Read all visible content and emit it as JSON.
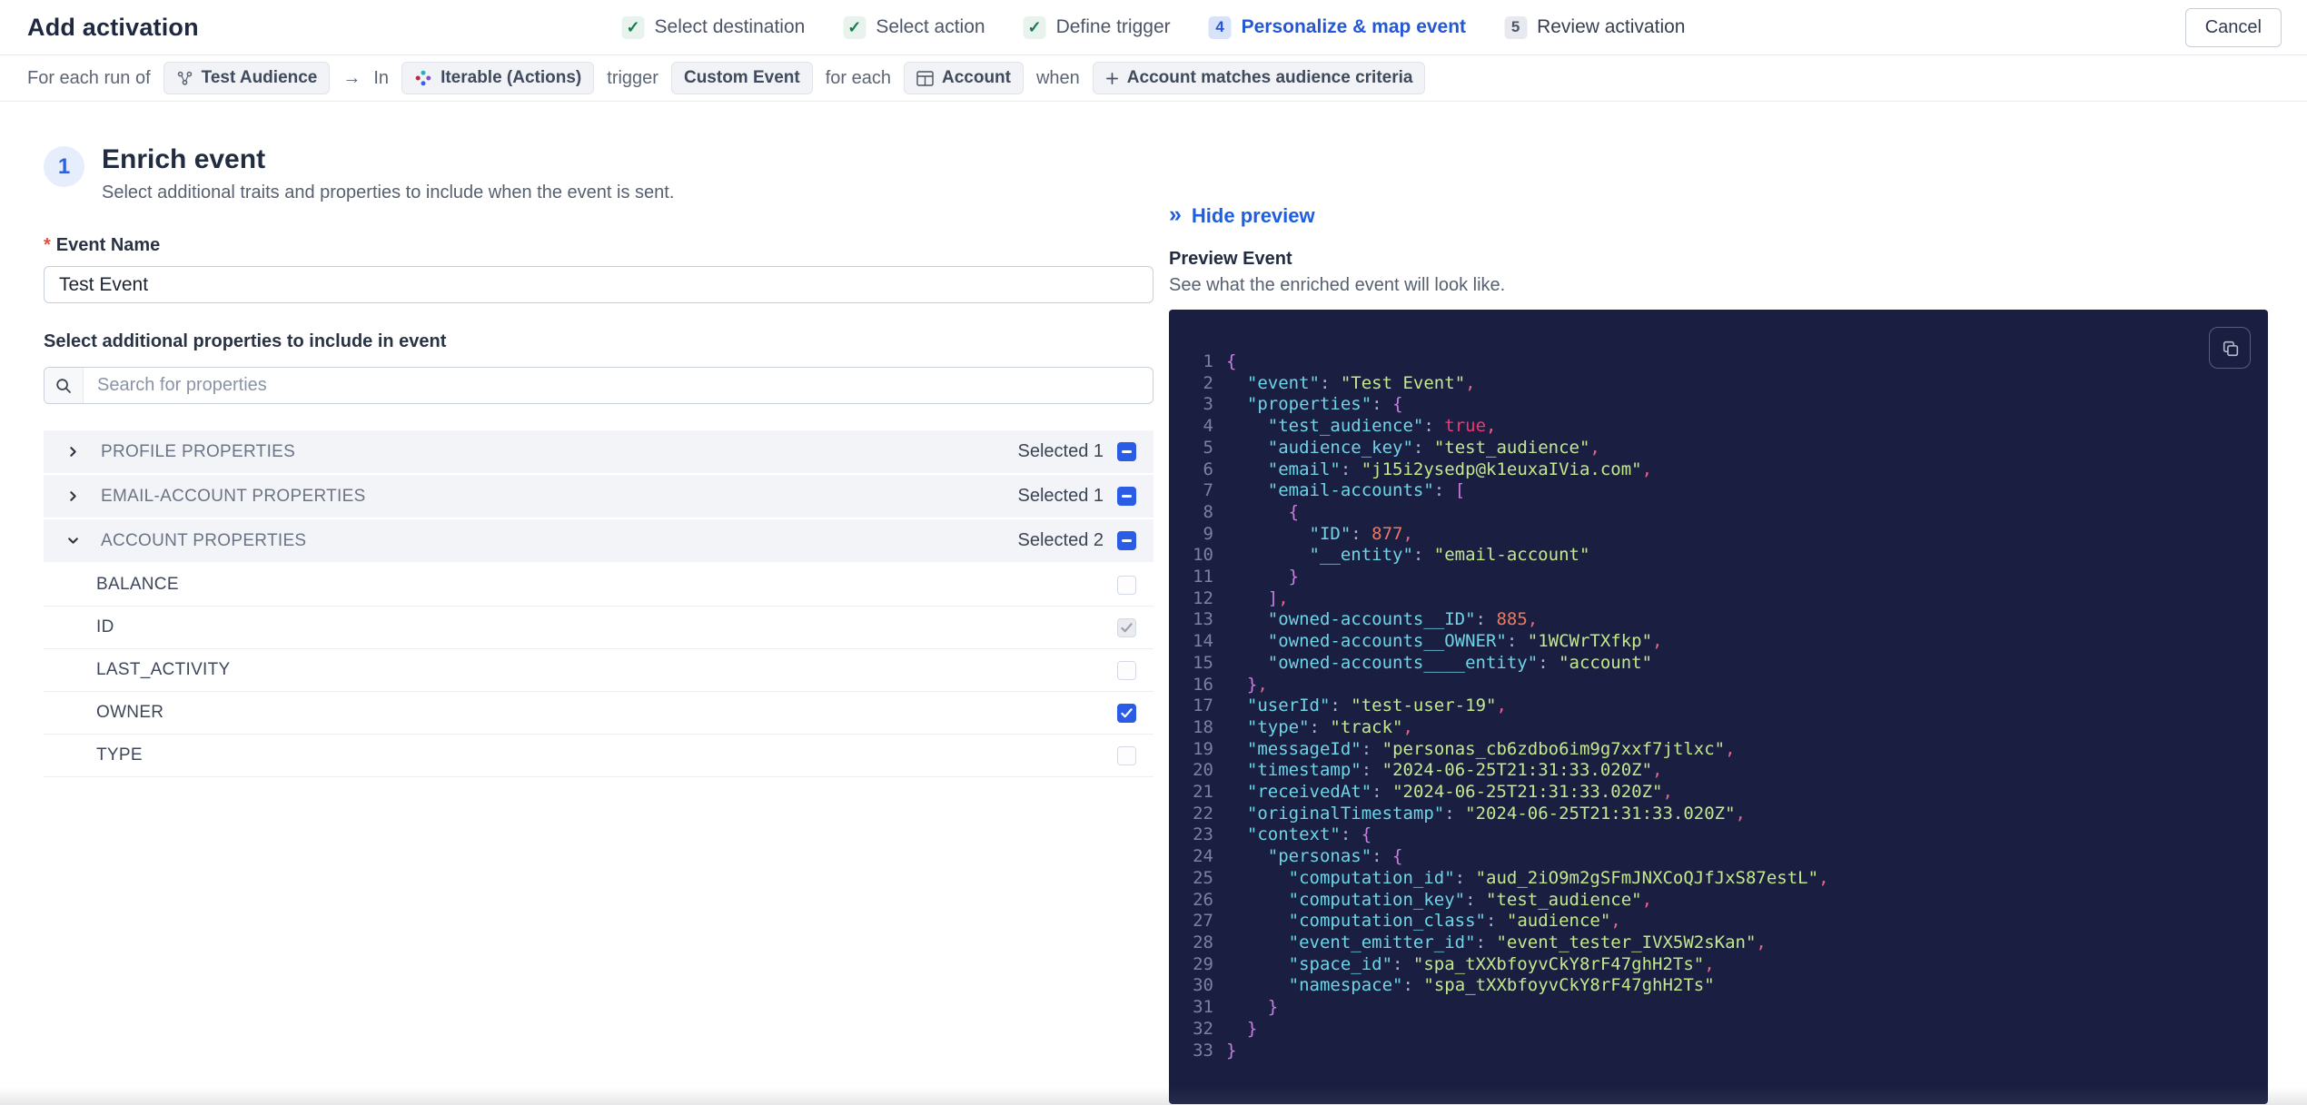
{
  "header": {
    "title": "Add activation",
    "cancel_label": "Cancel",
    "steps": [
      {
        "label": "Select destination",
        "state": "done"
      },
      {
        "label": "Select action",
        "state": "done"
      },
      {
        "label": "Define trigger",
        "state": "done"
      },
      {
        "label": "Personalize & map event",
        "state": "active",
        "number": "4"
      },
      {
        "label": "Review activation",
        "state": "upcoming",
        "number": "5"
      }
    ]
  },
  "context_bar": {
    "parts": [
      {
        "type": "text",
        "text": "For each run of"
      },
      {
        "type": "chip",
        "icon": "audience-icon",
        "label": "Test Audience"
      },
      {
        "type": "text",
        "text": "→"
      },
      {
        "type": "text",
        "text": "In"
      },
      {
        "type": "chip",
        "icon": "iterable-icon",
        "label": "Iterable (Actions)"
      },
      {
        "type": "text",
        "text": "trigger"
      },
      {
        "type": "chip",
        "icon": "",
        "label": "Custom Event"
      },
      {
        "type": "text",
        "text": "for each"
      },
      {
        "type": "chip",
        "icon": "table-icon",
        "label": "Account"
      },
      {
        "type": "text",
        "text": "when"
      },
      {
        "type": "chip",
        "icon": "plus-icon",
        "label": "Account matches audience criteria"
      }
    ]
  },
  "enrich": {
    "step_number": "1",
    "title": "Enrich event",
    "subtitle": "Select additional traits and properties to include when the event is sent.",
    "required_marker": "*",
    "event_name_label": "Event Name",
    "event_name_value": "Test Event",
    "properties_label": "Select additional properties to include in event",
    "search_placeholder": "Search for properties",
    "sections": [
      {
        "label": "PROFILE PROPERTIES",
        "selected": "Selected 1",
        "expanded": false,
        "items": []
      },
      {
        "label": "EMAIL-ACCOUNT PROPERTIES",
        "selected": "Selected 1",
        "expanded": false,
        "items": []
      },
      {
        "label": "ACCOUNT PROPERTIES",
        "selected": "Selected 2",
        "expanded": true,
        "items": [
          {
            "label": "BALANCE",
            "checkbox": "unchecked"
          },
          {
            "label": "ID",
            "checkbox": "checked-disabled"
          },
          {
            "label": "LAST_ACTIVITY",
            "checkbox": "unchecked"
          },
          {
            "label": "OWNER",
            "checkbox": "checked"
          },
          {
            "label": "TYPE",
            "checkbox": "unchecked"
          }
        ]
      }
    ]
  },
  "preview": {
    "hide_label": "Hide preview",
    "collapse_icon": "double-chevron-right-icon",
    "copy_icon": "copy-icon",
    "title": "Preview Event",
    "subtitle": "See what the enriched event will look like.",
    "code_lines": [
      {
        "n": 1,
        "indent": 0,
        "tokens": [
          [
            "brace",
            "{"
          ]
        ]
      },
      {
        "n": 2,
        "indent": 1,
        "tokens": [
          [
            "key",
            "\"event\""
          ],
          [
            "colon",
            ": "
          ],
          [
            "str",
            "\"Test Event\""
          ],
          [
            "comma",
            ","
          ]
        ]
      },
      {
        "n": 3,
        "indent": 1,
        "tokens": [
          [
            "key",
            "\"properties\""
          ],
          [
            "colon",
            ": "
          ],
          [
            "brace",
            "{"
          ]
        ]
      },
      {
        "n": 4,
        "indent": 2,
        "tokens": [
          [
            "key",
            "\"test_audience\""
          ],
          [
            "colon",
            ": "
          ],
          [
            "bool",
            "true"
          ],
          [
            "comma",
            ","
          ]
        ]
      },
      {
        "n": 5,
        "indent": 2,
        "tokens": [
          [
            "key",
            "\"audience_key\""
          ],
          [
            "colon",
            ": "
          ],
          [
            "str",
            "\"test_audience\""
          ],
          [
            "comma",
            ","
          ]
        ]
      },
      {
        "n": 6,
        "indent": 2,
        "tokens": [
          [
            "key",
            "\"email\""
          ],
          [
            "colon",
            ": "
          ],
          [
            "str",
            "\"j15i2ysedp@k1euxaIVia.com\""
          ],
          [
            "comma",
            ","
          ]
        ]
      },
      {
        "n": 7,
        "indent": 2,
        "tokens": [
          [
            "key",
            "\"email-accounts\""
          ],
          [
            "colon",
            ": "
          ],
          [
            "bracket",
            "["
          ]
        ]
      },
      {
        "n": 8,
        "indent": 3,
        "tokens": [
          [
            "brace",
            "{"
          ]
        ]
      },
      {
        "n": 9,
        "indent": 4,
        "tokens": [
          [
            "key",
            "\"ID\""
          ],
          [
            "colon",
            ": "
          ],
          [
            "num",
            "877"
          ],
          [
            "comma",
            ","
          ]
        ]
      },
      {
        "n": 10,
        "indent": 4,
        "tokens": [
          [
            "key",
            "\"__entity\""
          ],
          [
            "colon",
            ": "
          ],
          [
            "str",
            "\"email-account\""
          ]
        ]
      },
      {
        "n": 11,
        "indent": 3,
        "tokens": [
          [
            "brace",
            "}"
          ]
        ]
      },
      {
        "n": 12,
        "indent": 2,
        "tokens": [
          [
            "bracket",
            "]"
          ],
          [
            "comma",
            ","
          ]
        ]
      },
      {
        "n": 13,
        "indent": 2,
        "tokens": [
          [
            "key",
            "\"owned-accounts__ID\""
          ],
          [
            "colon",
            ": "
          ],
          [
            "num",
            "885"
          ],
          [
            "comma",
            ","
          ]
        ]
      },
      {
        "n": 14,
        "indent": 2,
        "tokens": [
          [
            "key",
            "\"owned-accounts__OWNER\""
          ],
          [
            "colon",
            ": "
          ],
          [
            "str",
            "\"1WCWrTXfkp\""
          ],
          [
            "comma",
            ","
          ]
        ]
      },
      {
        "n": 15,
        "indent": 2,
        "tokens": [
          [
            "key",
            "\"owned-accounts____entity\""
          ],
          [
            "colon",
            ": "
          ],
          [
            "str",
            "\"account\""
          ]
        ]
      },
      {
        "n": 16,
        "indent": 1,
        "tokens": [
          [
            "brace",
            "}"
          ],
          [
            "comma",
            ","
          ]
        ]
      },
      {
        "n": 17,
        "indent": 1,
        "tokens": [
          [
            "key",
            "\"userId\""
          ],
          [
            "colon",
            ": "
          ],
          [
            "str",
            "\"test-user-19\""
          ],
          [
            "comma",
            ","
          ]
        ]
      },
      {
        "n": 18,
        "indent": 1,
        "tokens": [
          [
            "key",
            "\"type\""
          ],
          [
            "colon",
            ": "
          ],
          [
            "str",
            "\"track\""
          ],
          [
            "comma",
            ","
          ]
        ]
      },
      {
        "n": 19,
        "indent": 1,
        "tokens": [
          [
            "key",
            "\"messageId\""
          ],
          [
            "colon",
            ": "
          ],
          [
            "str",
            "\"personas_cb6zdbo6im9g7xxf7jtlxc\""
          ],
          [
            "comma",
            ","
          ]
        ]
      },
      {
        "n": 20,
        "indent": 1,
        "tokens": [
          [
            "key",
            "\"timestamp\""
          ],
          [
            "colon",
            ": "
          ],
          [
            "str",
            "\"2024-06-25T21:31:33.020Z\""
          ],
          [
            "comma",
            ","
          ]
        ]
      },
      {
        "n": 21,
        "indent": 1,
        "tokens": [
          [
            "key",
            "\"receivedAt\""
          ],
          [
            "colon",
            ": "
          ],
          [
            "str",
            "\"2024-06-25T21:31:33.020Z\""
          ],
          [
            "comma",
            ","
          ]
        ]
      },
      {
        "n": 22,
        "indent": 1,
        "tokens": [
          [
            "key",
            "\"originalTimestamp\""
          ],
          [
            "colon",
            ": "
          ],
          [
            "str",
            "\"2024-06-25T21:31:33.020Z\""
          ],
          [
            "comma",
            ","
          ]
        ]
      },
      {
        "n": 23,
        "indent": 1,
        "tokens": [
          [
            "key",
            "\"context\""
          ],
          [
            "colon",
            ": "
          ],
          [
            "brace",
            "{"
          ]
        ]
      },
      {
        "n": 24,
        "indent": 2,
        "tokens": [
          [
            "key",
            "\"personas\""
          ],
          [
            "colon",
            ": "
          ],
          [
            "brace",
            "{"
          ]
        ]
      },
      {
        "n": 25,
        "indent": 3,
        "tokens": [
          [
            "key",
            "\"computation_id\""
          ],
          [
            "colon",
            ": "
          ],
          [
            "str",
            "\"aud_2iO9m2gSFmJNXCoQJfJxS87estL\""
          ],
          [
            "comma",
            ","
          ]
        ]
      },
      {
        "n": 26,
        "indent": 3,
        "tokens": [
          [
            "key",
            "\"computation_key\""
          ],
          [
            "colon",
            ": "
          ],
          [
            "str",
            "\"test_audience\""
          ],
          [
            "comma",
            ","
          ]
        ]
      },
      {
        "n": 27,
        "indent": 3,
        "tokens": [
          [
            "key",
            "\"computation_class\""
          ],
          [
            "colon",
            ": "
          ],
          [
            "str",
            "\"audience\""
          ],
          [
            "comma",
            ","
          ]
        ]
      },
      {
        "n": 28,
        "indent": 3,
        "tokens": [
          [
            "key",
            "\"event_emitter_id\""
          ],
          [
            "colon",
            ": "
          ],
          [
            "str",
            "\"event_tester_IVX5W2sKan\""
          ],
          [
            "comma",
            ","
          ]
        ]
      },
      {
        "n": 29,
        "indent": 3,
        "tokens": [
          [
            "key",
            "\"space_id\""
          ],
          [
            "colon",
            ": "
          ],
          [
            "str",
            "\"spa_tXXbfoyvCkY8rF47ghH2Ts\""
          ],
          [
            "comma",
            ","
          ]
        ]
      },
      {
        "n": 30,
        "indent": 3,
        "tokens": [
          [
            "key",
            "\"namespace\""
          ],
          [
            "colon",
            ": "
          ],
          [
            "str",
            "\"spa_tXXbfoyvCkY8rF47ghH2Ts\""
          ]
        ]
      },
      {
        "n": 31,
        "indent": 2,
        "tokens": [
          [
            "brace",
            "}"
          ]
        ]
      },
      {
        "n": 32,
        "indent": 1,
        "tokens": [
          [
            "brace",
            "}"
          ]
        ]
      },
      {
        "n": 33,
        "indent": 0,
        "tokens": [
          [
            "brace",
            "}"
          ]
        ]
      }
    ]
  },
  "colors": {
    "accent_blue": "#2b5ce6",
    "active_step_blue": "#2457d6",
    "success_green": "#157a4e",
    "code_background": "#1a1f42",
    "code_key": "#6fd4e6",
    "code_string": "#c3e88d",
    "code_number": "#f0795b",
    "code_boolean": "#f2366f",
    "code_punctuation": "#c97fe0",
    "required_red": "#e15241"
  }
}
